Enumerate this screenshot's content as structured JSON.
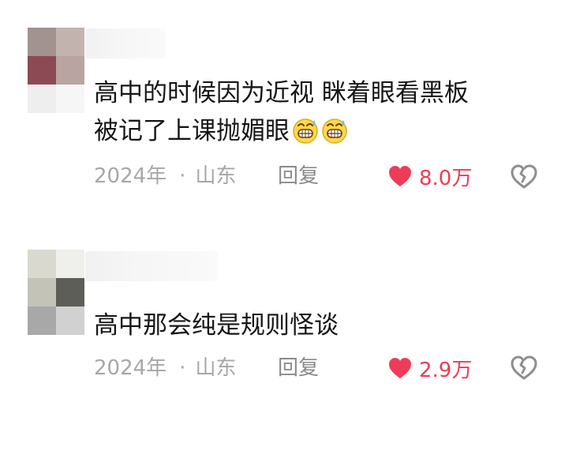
{
  "comments": [
    {
      "line1": "高中的时候因为近视  眯着眼看黑板",
      "line2": "被记了上课抛媚眼",
      "emoji_count": 2,
      "emoji_name": "grinning-sweat-emoji",
      "year": "2024年",
      "separator": "·",
      "location": "山东",
      "reply_label": "回复",
      "likes": "8.0万"
    },
    {
      "line1": "高中那会纯是规则怪谈",
      "year": "2024年",
      "separator": "·",
      "location": "山东",
      "reply_label": "回复",
      "likes": "2.9万"
    }
  ],
  "icons": {
    "like": "heart-icon",
    "dislike": "broken-heart-icon"
  },
  "colors": {
    "like_red": "#ee3b58",
    "meta_gray": "#a7a7a7",
    "text": "#161616"
  }
}
